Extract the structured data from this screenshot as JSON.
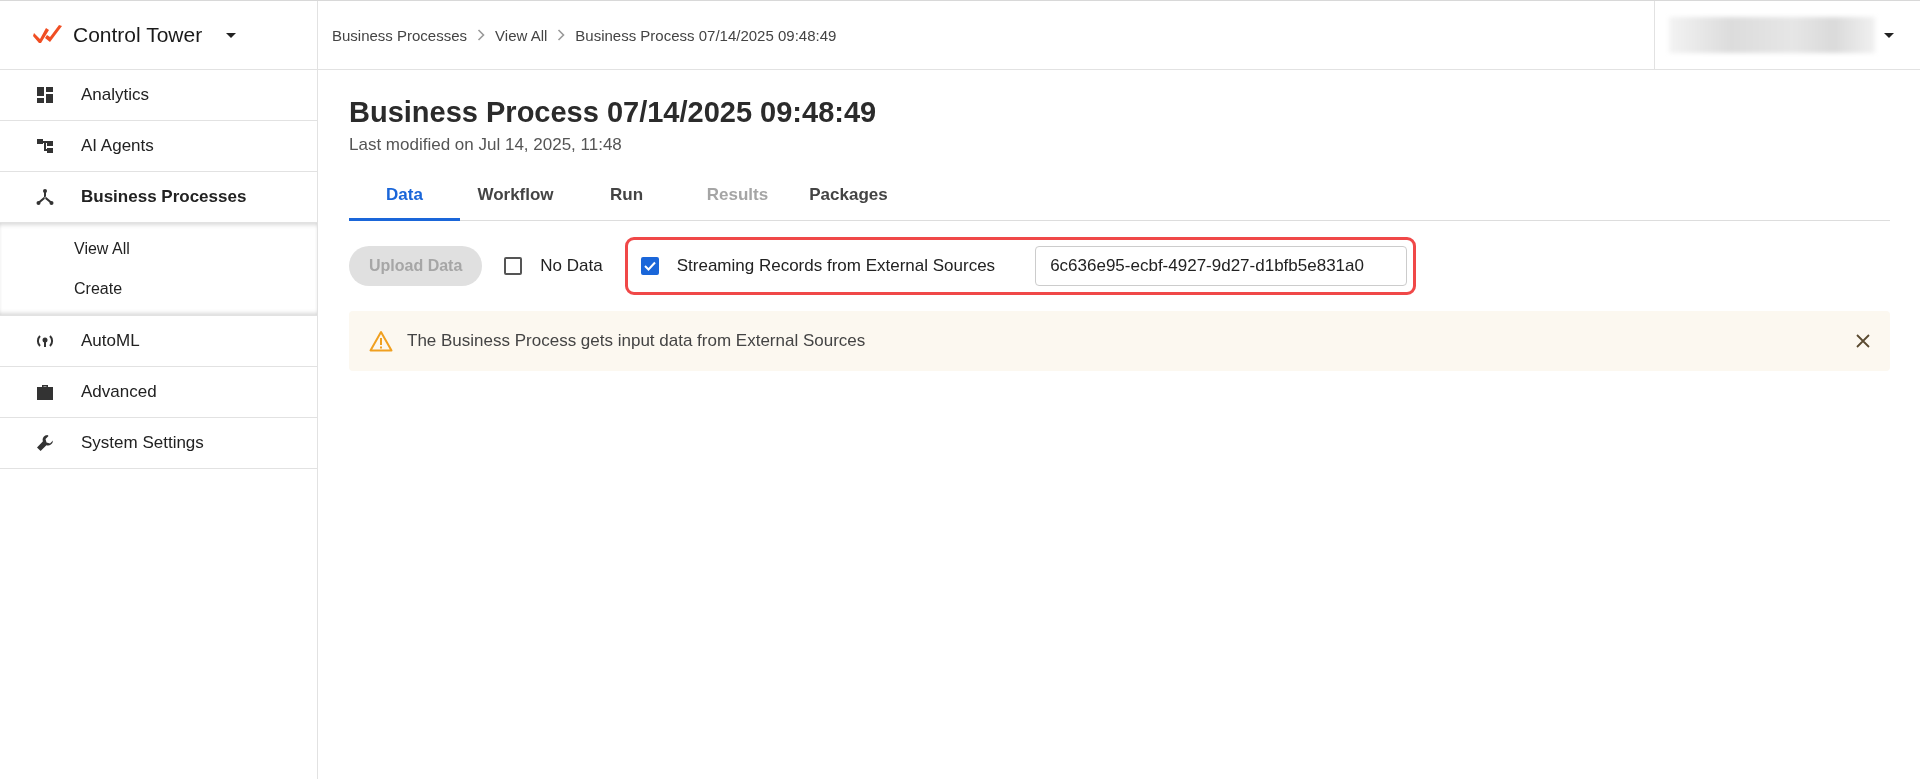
{
  "app": {
    "name": "Control Tower"
  },
  "sidebar": {
    "items": [
      {
        "label": "Analytics",
        "selected": false
      },
      {
        "label": "AI Agents",
        "selected": false
      },
      {
        "label": "Business Processes",
        "selected": true,
        "expanded": true,
        "children": [
          {
            "label": "View All",
            "selected": false
          },
          {
            "label": "Create",
            "selected": false
          }
        ]
      },
      {
        "label": "AutoML",
        "selected": false
      },
      {
        "label": "Advanced",
        "selected": false
      },
      {
        "label": "System Settings",
        "selected": false
      }
    ]
  },
  "breadcrumbs": [
    "Business Processes",
    "View All",
    "Business Process 07/14/2025 09:48:49"
  ],
  "page": {
    "title": "Business Process 07/14/2025 09:48:49",
    "subtitle": "Last modified on Jul 14, 2025, 11:48"
  },
  "tabs": [
    {
      "label": "Data",
      "selected": true,
      "disabled": false
    },
    {
      "label": "Workflow",
      "selected": false,
      "disabled": false
    },
    {
      "label": "Run",
      "selected": false,
      "disabled": false
    },
    {
      "label": "Results",
      "selected": false,
      "disabled": true
    },
    {
      "label": "Packages",
      "selected": false,
      "disabled": false
    }
  ],
  "data_panel": {
    "upload_button": {
      "label": "Upload Data",
      "disabled": true
    },
    "no_data": {
      "label": "No Data",
      "checked": false
    },
    "streaming": {
      "label": "Streaming Records from External Sources",
      "checked": true,
      "highlighted": true
    },
    "source_id": {
      "value": "6c636e95-ecbf-4927-9d27-d1bfb5e831a0"
    },
    "alert": {
      "kind": "warning",
      "text": "The Business Process gets input data from External Sources"
    }
  }
}
